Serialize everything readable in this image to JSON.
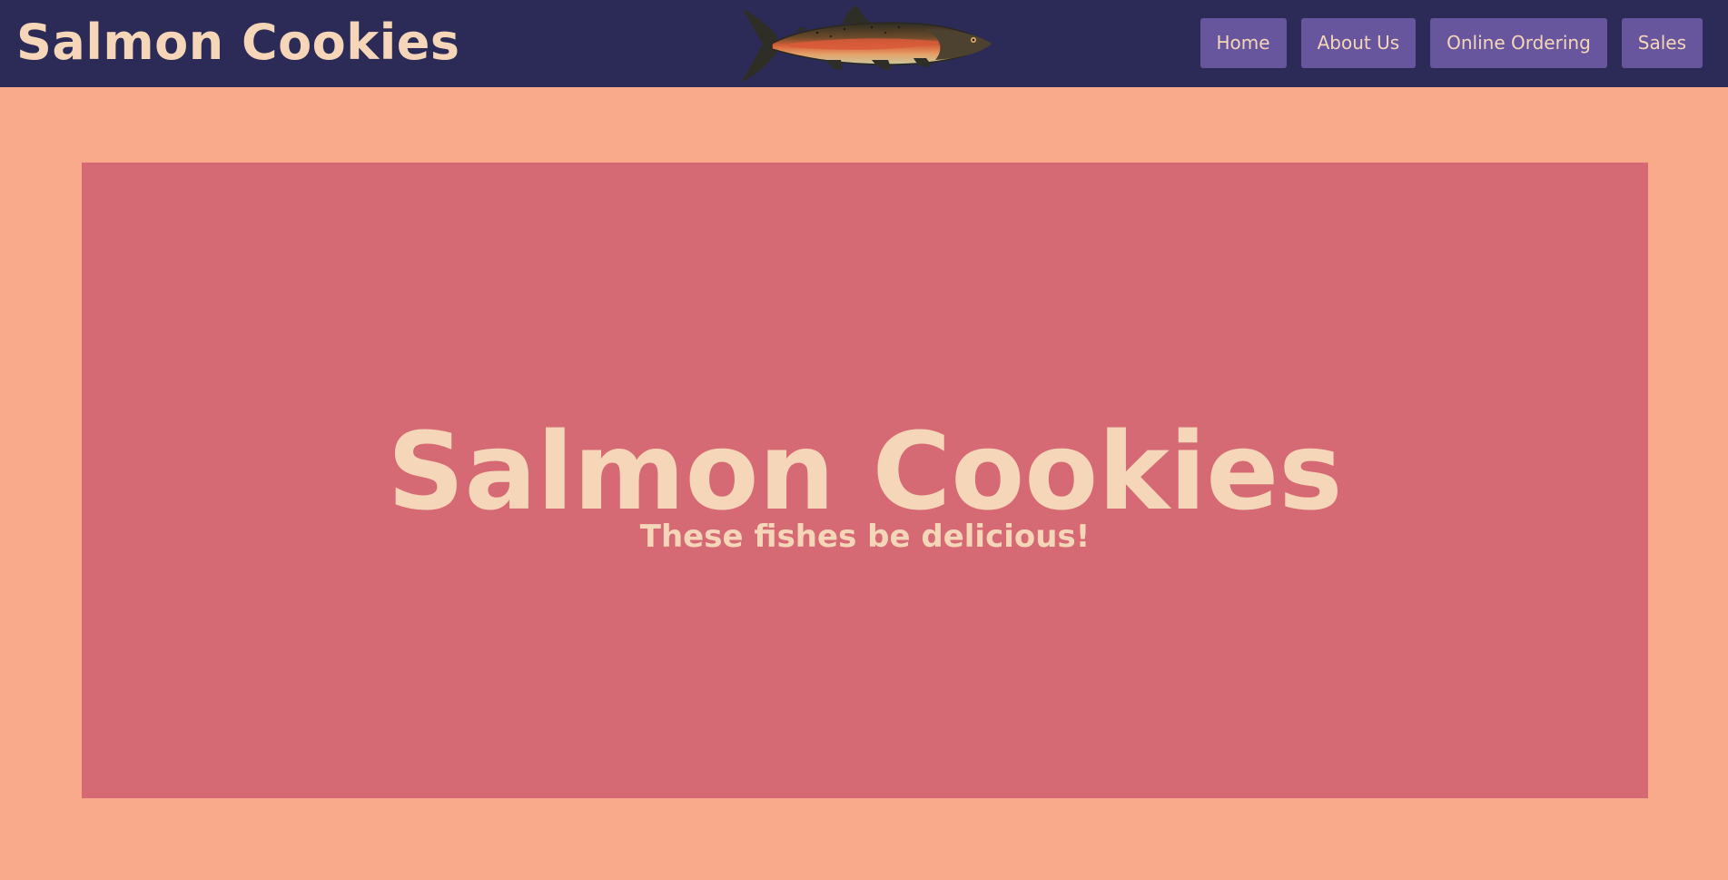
{
  "header": {
    "site_title": "Salmon Cookies",
    "logo_icon": "salmon-fish-icon"
  },
  "nav": {
    "items": [
      {
        "label": "Home"
      },
      {
        "label": "About Us"
      },
      {
        "label": "Online Ordering"
      },
      {
        "label": "Sales"
      }
    ]
  },
  "hero": {
    "title": "Salmon Cookies",
    "subtitle": "These fishes be delicious!"
  },
  "colors": {
    "header_bg": "#2c2b57",
    "page_bg": "#f9aa8b",
    "hero_bg": "#d66a74",
    "nav_button_bg": "#67569e",
    "text": "#f6d6b9"
  }
}
